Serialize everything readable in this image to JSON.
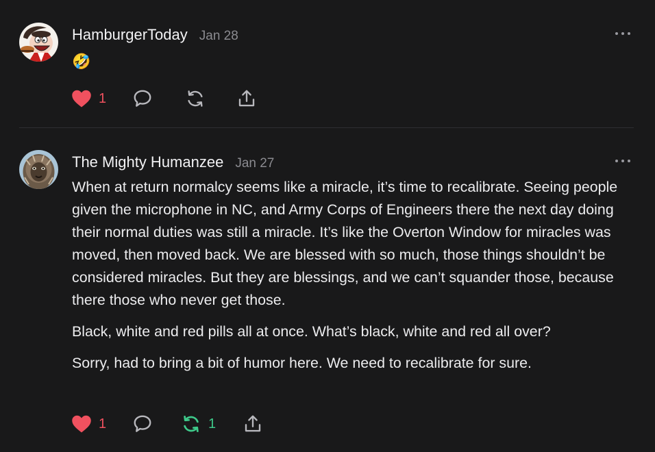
{
  "colors": {
    "background": "#19191a",
    "text": "#ececee",
    "muted": "#8b8b90",
    "like": "#f0515f",
    "restack_active": "#3ec98a",
    "icon": "#b8b8bd"
  },
  "posts": [
    {
      "author": "HamburgerToday",
      "date": "Jan 28",
      "content": [
        "🤣"
      ],
      "likes": "1",
      "restacks": "",
      "restacked": false,
      "icons": [
        "heart-icon",
        "comment-icon",
        "restack-icon",
        "share-icon"
      ]
    },
    {
      "author": "The Mighty Humanzee",
      "date": "Jan 27",
      "content": [
        "When at return normalcy seems like a miracle, it’s time to recalibrate. Seeing people given the microphone in NC, and Army Corps of Engineers there the next day doing their normal duties was still a miracle. It’s like the Overton Window for miracles was moved, then moved back. We are blessed with so much, those things shouldn’t be considered miracles. But they are blessings, and we can’t squander those, because there those who never get those.",
        "Black, white and red pills all at once. What’s black, white and red all over?",
        "Sorry, had to bring a bit of humor here. We need to recalibrate for sure."
      ],
      "likes": "1",
      "restacks": "1",
      "restacked": true,
      "icons": [
        "heart-icon",
        "comment-icon",
        "restack-icon",
        "share-icon"
      ]
    }
  ]
}
